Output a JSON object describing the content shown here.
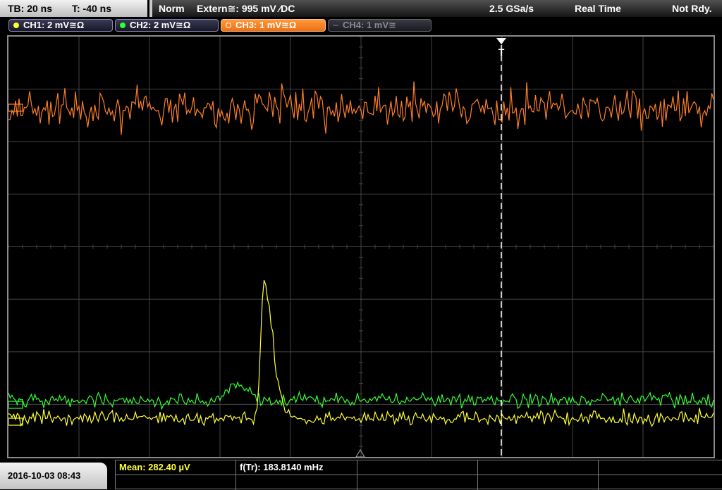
{
  "status": {
    "timebase": "TB: 20 ns",
    "trigger_time": "T: -40 ns",
    "acq_mode": "Norm",
    "trigger_source": "Extern≅: 995 mV ⁄DC",
    "sample_rate": "2.5 GSa/s",
    "acq_type": "Real Time",
    "trigger_state": "Not Rdy."
  },
  "channels": [
    {
      "label": "CH1: 2 mV≅Ω",
      "color": "#ffff33",
      "active": false
    },
    {
      "label": "CH2: 2 mV≅Ω",
      "color": "#33ff33",
      "active": false
    },
    {
      "label": "CH3: 1 mV≅Ω",
      "color": "#ff7f27",
      "active": true
    },
    {
      "label": "CH4: 1 mV≅",
      "color": "#888888",
      "active": false,
      "disabled": true
    }
  ],
  "trigger_marker": "T",
  "measurements": {
    "mean_label": "Mean: 282.40 µV",
    "freq_label": "f(Tr): 183.8140 mHz"
  },
  "datetime": "2016-10-03 08:43",
  "colors": {
    "ch1": "#ffff33",
    "ch2": "#33ff33",
    "ch3": "#ff7f27",
    "grid": "#444444",
    "trigger_line": "#ffffff"
  }
}
